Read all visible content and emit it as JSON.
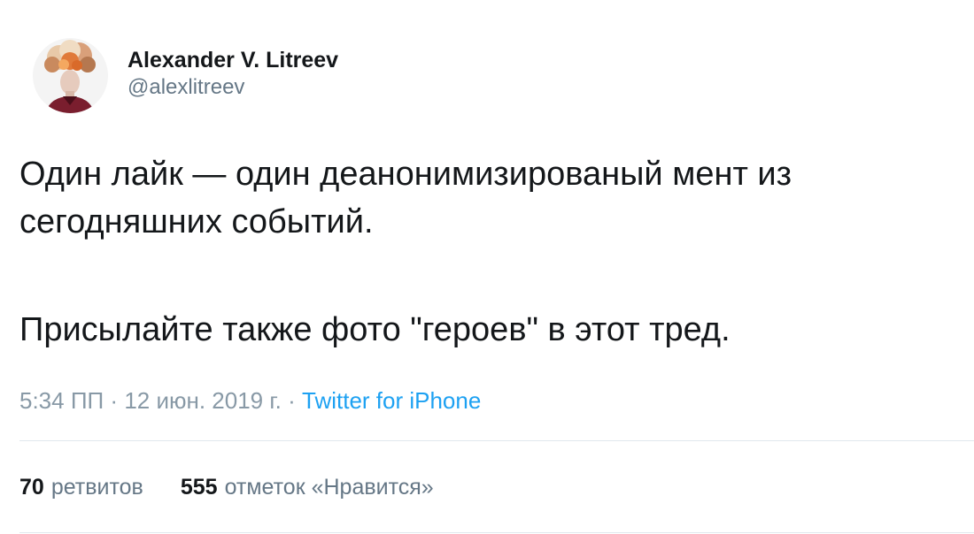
{
  "author": {
    "display_name": "Alexander V. Litreev",
    "handle": "@alexlitreev",
    "avatar": "profile-photo"
  },
  "tweet": {
    "line1": "Один лайк — один деанонимизированый мент из",
    "line2": "сегодняшних событий.",
    "line3": "Присылайте также фото \"героев\" в этот тред."
  },
  "meta": {
    "time": "5:34 ПП",
    "sep1": " · ",
    "date": "12 июн. 2019 г.",
    "sep2": " · ",
    "source": "Twitter for iPhone"
  },
  "stats": {
    "retweets_count": "70",
    "retweets_label": "ретвитов",
    "likes_count": "555",
    "likes_label": "отметок «Нравится»"
  },
  "colors": {
    "text": "#14171a",
    "secondary": "#657786",
    "muted": "#8899a6",
    "link": "#1da1f2",
    "divider": "#e1e8ed"
  }
}
